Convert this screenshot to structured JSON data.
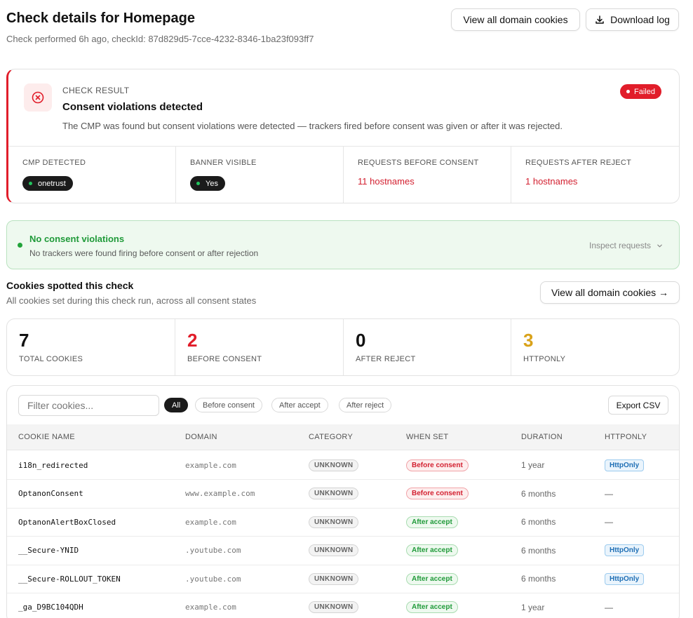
{
  "header": {
    "title": "Check details for Homepage",
    "subtitle": "Check performed 6h ago, checkId: 87d829d5-7cce-4232-8346-1ba23f093ff7",
    "view_all_label": "View all domain cookies",
    "download_label": "Download log"
  },
  "result": {
    "kicker": "CHECK RESULT",
    "title": "Consent violations detected",
    "description": "The CMP was found but consent violations were detected — trackers fired before consent was given or after it was rejected.",
    "status": "Failed",
    "status_color": "#e11d2a",
    "metrics": [
      {
        "label": "CMP DETECTED",
        "value": "onetrust"
      },
      {
        "label": "BANNER VISIBLE",
        "value": "Yes"
      },
      {
        "label": "REQUESTS BEFORE CONSENT",
        "value": "11 hostnames"
      },
      {
        "label": "REQUESTS AFTER REJECT",
        "value": "1 hostnames"
      }
    ]
  },
  "ok_banner": {
    "title": "No consent violations",
    "description": "No trackers were found firing before consent or after rejection",
    "inspect_label": "Inspect requests"
  },
  "cookies_section": {
    "title": "Cookies spotted this check",
    "subtitle": "All cookies set during this check run, across all consent states",
    "view_all_label": "View all domain cookies →"
  },
  "stats": [
    {
      "value": "7",
      "label": "TOTAL COOKIES",
      "color": "#111111"
    },
    {
      "value": "2",
      "label": "BEFORE CONSENT",
      "color": "#e11d2a"
    },
    {
      "value": "0",
      "label": "AFTER REJECT",
      "color": "#111111"
    },
    {
      "value": "3",
      "label": "HTTPONLY",
      "color": "#d9a21a"
    }
  ],
  "table": {
    "filter_placeholder": "Filter cookies...",
    "filters": [
      "All",
      "Before consent",
      "After accept",
      "After reject"
    ],
    "export_label": "Export CSV",
    "columns": [
      "COOKIE NAME",
      "DOMAIN",
      "CATEGORY",
      "WHEN SET",
      "DURATION",
      "HTTPONLY"
    ],
    "rows": [
      {
        "name": "i18n_redirected",
        "domain": "example.com",
        "category": "UNKNOWN",
        "when": "Before consent",
        "duration": "1 year",
        "httponly": "HttpOnly"
      },
      {
        "name": "OptanonConsent",
        "domain": "www.example.com",
        "category": "UNKNOWN",
        "when": "Before consent",
        "duration": "6 months",
        "httponly": "—"
      },
      {
        "name": "OptanonAlertBoxClosed",
        "domain": "example.com",
        "category": "UNKNOWN",
        "when": "After accept",
        "duration": "6 months",
        "httponly": "—"
      },
      {
        "name": "__Secure-YNID",
        "domain": ".youtube.com",
        "category": "UNKNOWN",
        "when": "After accept",
        "duration": "6 months",
        "httponly": "HttpOnly"
      },
      {
        "name": "__Secure-ROLLOUT_TOKEN",
        "domain": ".youtube.com",
        "category": "UNKNOWN",
        "when": "After accept",
        "duration": "6 months",
        "httponly": "HttpOnly"
      },
      {
        "name": "_ga_D9BC104QDH",
        "domain": "example.com",
        "category": "UNKNOWN",
        "when": "After accept",
        "duration": "1 year",
        "httponly": "—"
      }
    ]
  }
}
